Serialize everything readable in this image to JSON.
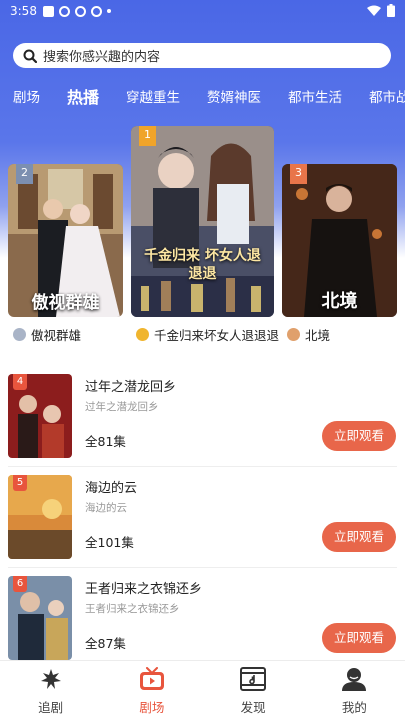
{
  "status_bar": {
    "time": "3:58"
  },
  "search": {
    "placeholder": "搜索你感兴趣的内容"
  },
  "category_tabs": [
    {
      "label": "剧场"
    },
    {
      "label": "热播"
    },
    {
      "label": "穿越重生"
    },
    {
      "label": "赘婿神医"
    },
    {
      "label": "都市生活"
    },
    {
      "label": "都市战"
    }
  ],
  "top_ranking": [
    {
      "rank": "2",
      "poster_text": "傲视群雄",
      "name": "傲视群雄"
    },
    {
      "rank": "1",
      "poster_text": "千金归来 坏女人退退退",
      "name": "千金归来坏女人退退退"
    },
    {
      "rank": "3",
      "poster_text": "北境",
      "name": "北境"
    }
  ],
  "list": [
    {
      "rank": "4",
      "title": "过年之潜龙回乡",
      "subtitle": "过年之潜龙回乡",
      "episodes": "全81集",
      "button": "立即观看"
    },
    {
      "rank": "5",
      "title": "海边的云",
      "subtitle": "海边的云",
      "episodes": "全101集",
      "button": "立即观看"
    },
    {
      "rank": "6",
      "title": "王者归来之衣锦还乡",
      "subtitle": "王者归来之衣锦还乡",
      "episodes": "全87集",
      "button": "立即观看"
    }
  ],
  "bottom_nav": [
    {
      "label": "追剧",
      "icon": "chase-drama-icon"
    },
    {
      "label": "剧场",
      "icon": "tv-icon"
    },
    {
      "label": "发现",
      "icon": "discover-film-icon"
    },
    {
      "label": "我的",
      "icon": "profile-icon"
    }
  ],
  "colors": {
    "header_blue": "#4a67e6",
    "accent": "#e8553d",
    "button": "#e8664a"
  }
}
